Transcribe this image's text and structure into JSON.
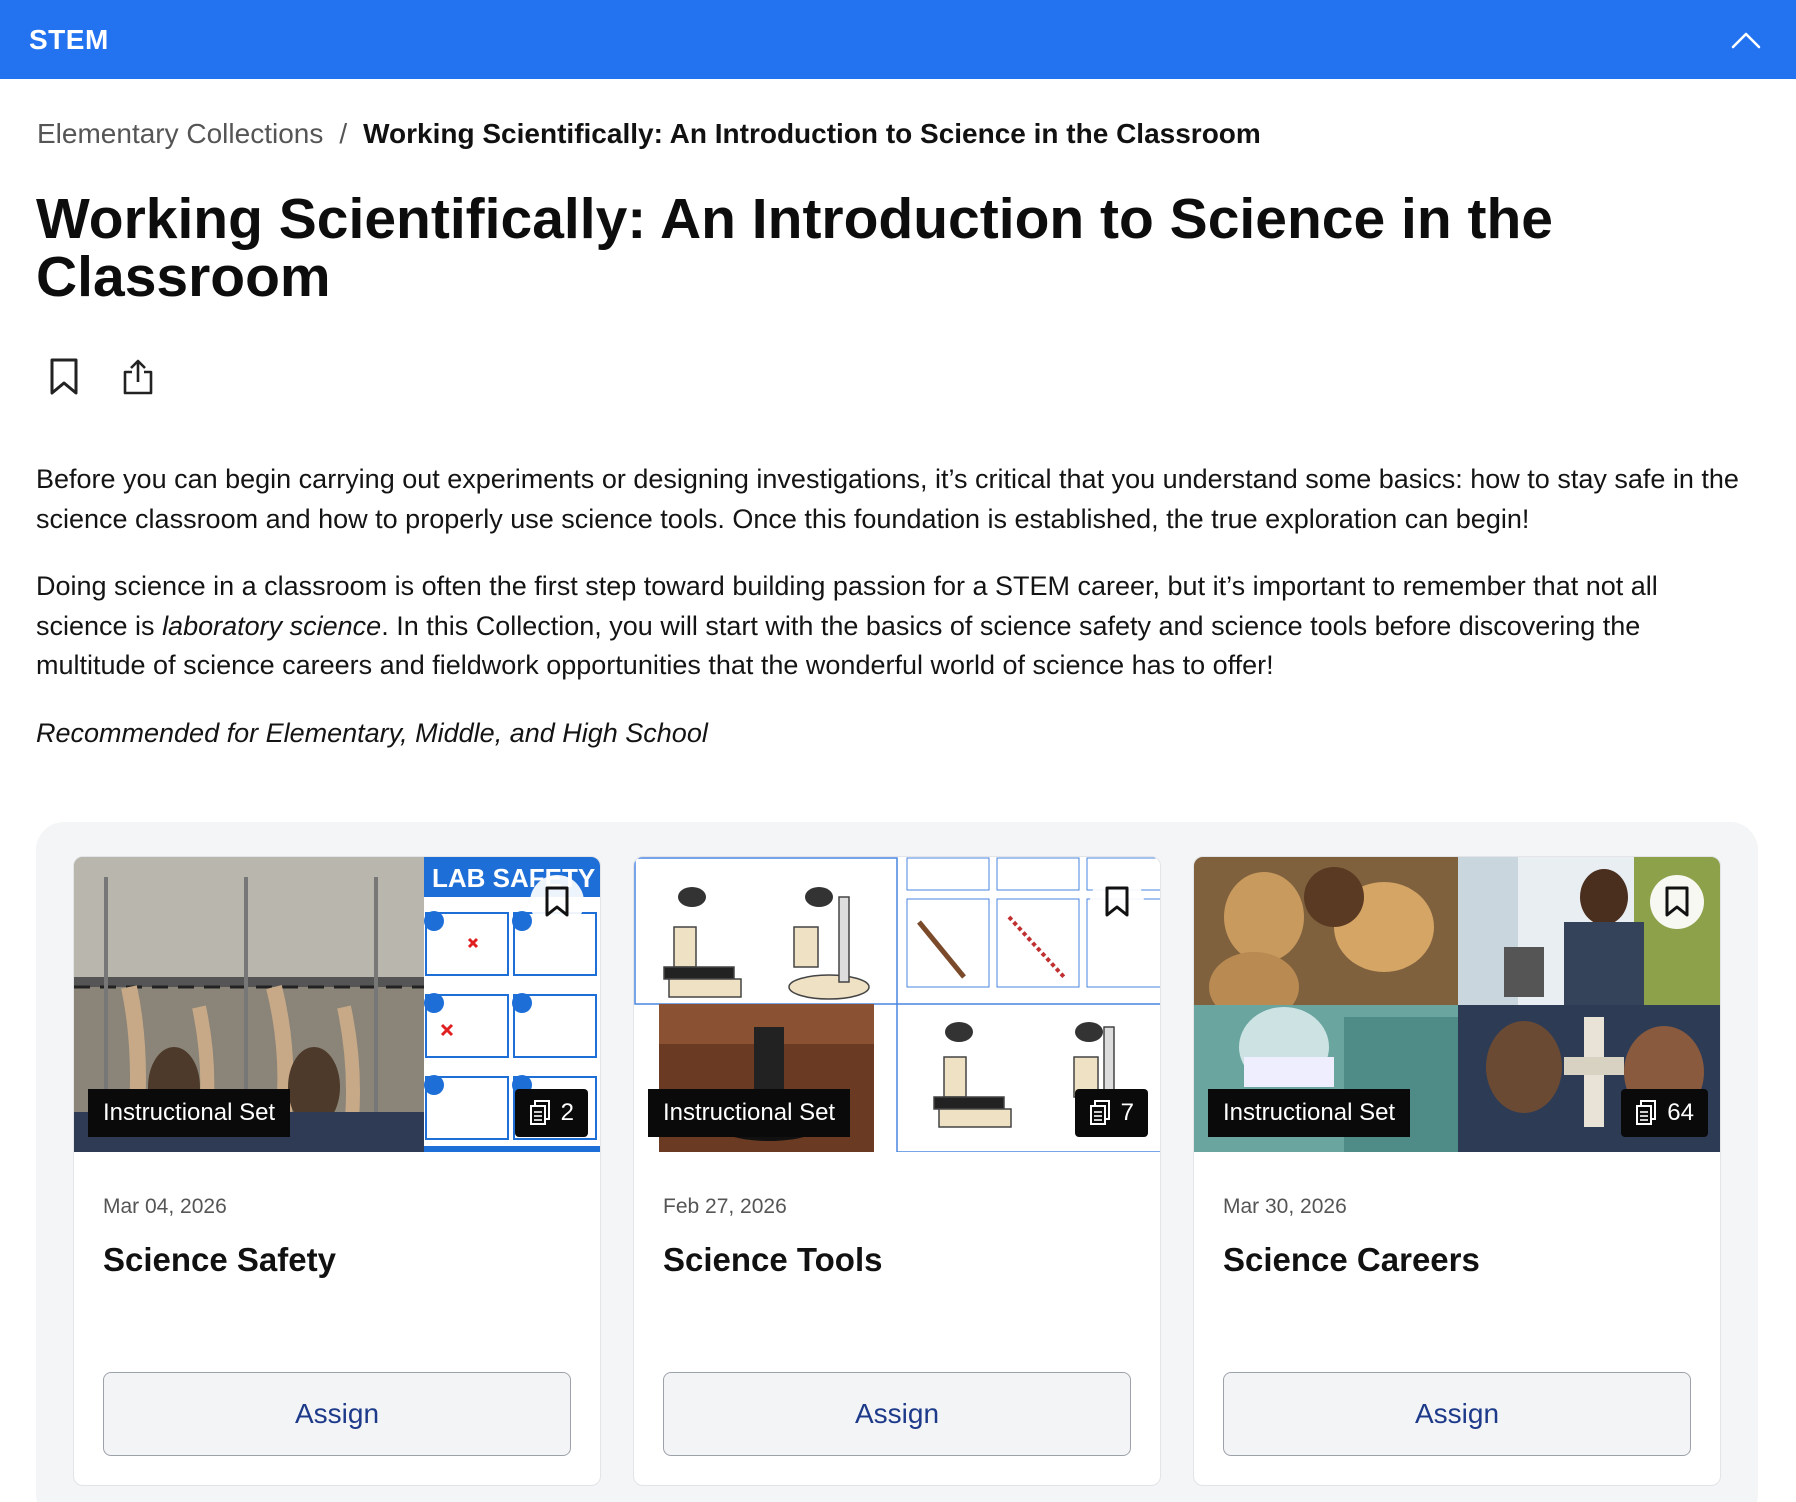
{
  "header": {
    "brand": "STEM"
  },
  "breadcrumb": {
    "parent": "Elementary Collections",
    "separator": "/",
    "current": "Working Scientifically: An Introduction to Science in the Classroom"
  },
  "page": {
    "title": "Working Scientifically: An Introduction to Science in the Classroom",
    "paragraph1": "Before you can begin carrying out experiments or designing investigations, it’s critical that you understand some basics: how to stay safe in the science classroom and how to properly use science tools. Once this foundation is established, the true exploration can begin!",
    "paragraph2_before": "Doing science in a classroom is often the first step toward building passion for a STEM career, but it’s important to remember that not all science is ",
    "paragraph2_em": "laboratory science",
    "paragraph2_after": ". In this Collection, you will start with the basics of science safety and science tools before discovering the multitude of science careers and fieldwork opportunities that the wonderful world of science has to offer!",
    "recommended": "Recommended for Elementary, Middle, and High School"
  },
  "cards": [
    {
      "tag": "Instructional Set",
      "count": "2",
      "date": "Mar 04, 2026",
      "title": "Science Safety",
      "assign": "Assign",
      "thumb_label": "LAB SAFETY"
    },
    {
      "tag": "Instructional Set",
      "count": "7",
      "date": "Feb 27, 2026",
      "title": "Science Tools",
      "assign": "Assign"
    },
    {
      "tag": "Instructional Set",
      "count": "64",
      "date": "Mar 30, 2026",
      "title": "Science Careers",
      "assign": "Assign"
    }
  ],
  "icons": {
    "collapse": "chevron-up-icon",
    "bookmark": "bookmark-icon",
    "share": "share-icon",
    "resources": "documents-icon"
  },
  "colors": {
    "header": "#2372f0",
    "assign_text": "#1d3a8a",
    "tag_bg": "#0a0a0a"
  }
}
